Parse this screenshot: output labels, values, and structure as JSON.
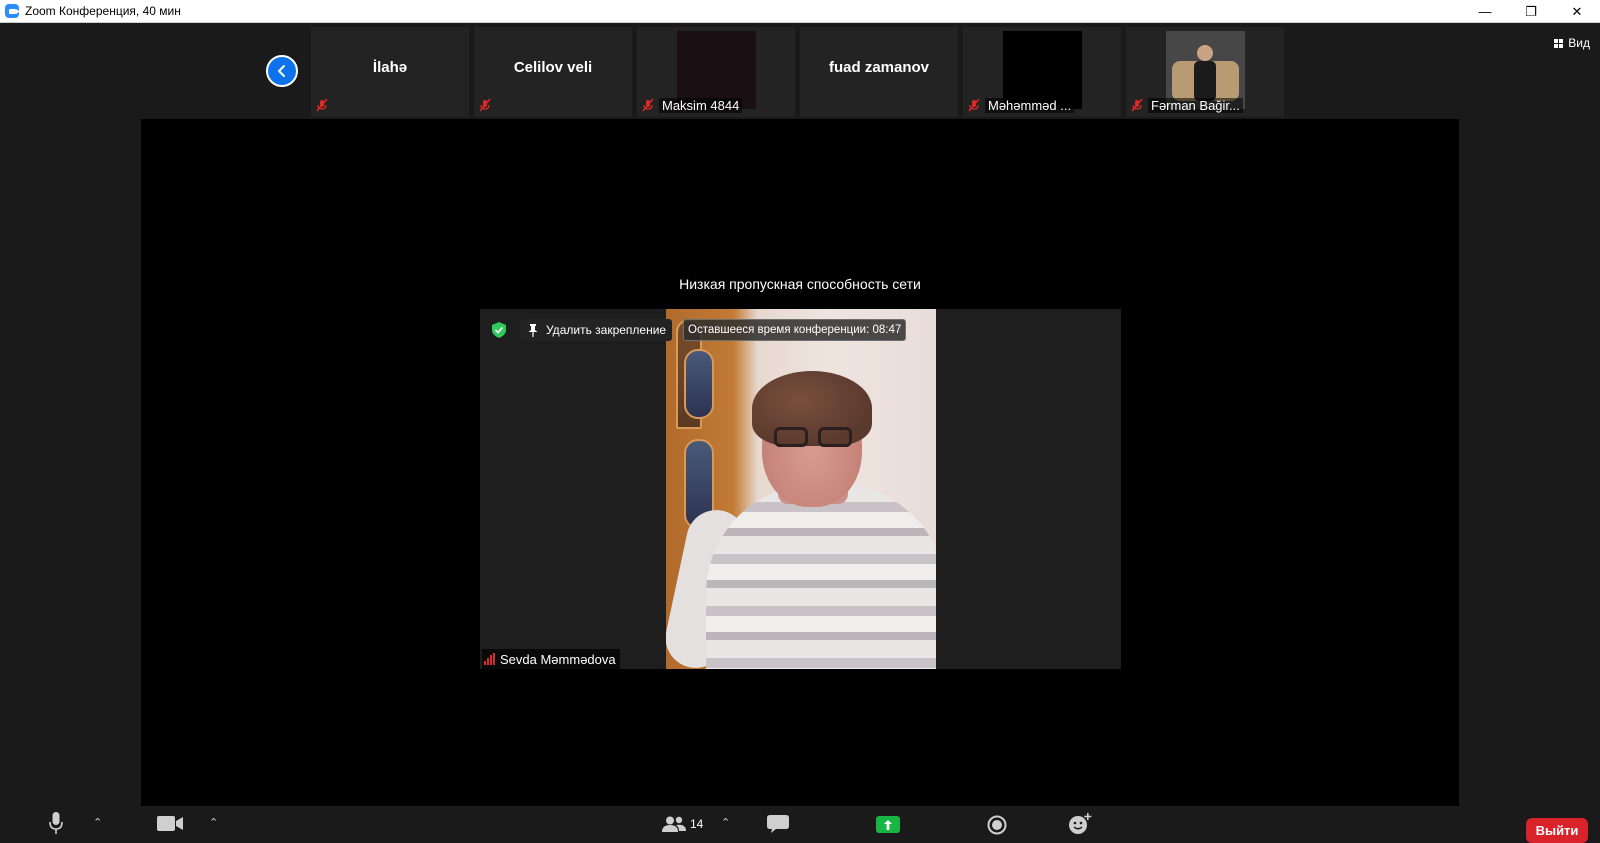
{
  "window": {
    "title": "Zoom Конференция, 40 мин",
    "controls": [
      "—",
      "❐",
      "✕"
    ]
  },
  "strip": {
    "tiles": [
      {
        "name": "İlahə",
        "display": "text",
        "muted": true
      },
      {
        "name": "Celilov veli",
        "display": "text",
        "muted": true
      },
      {
        "name": "Maksim 4844",
        "display": "video",
        "muted": true
      },
      {
        "name": "fuad zamanov",
        "display": "text",
        "muted": false
      },
      {
        "name": "Məhəmməd ...",
        "display": "video",
        "muted": true
      },
      {
        "name": "Fərman Bağir...",
        "display": "video",
        "muted": true
      }
    ],
    "view_label": "Вид"
  },
  "stage": {
    "bandwidth_notice": "Низкая пропускная способность сети",
    "unpin_label": "Удалить закрепление",
    "time_remaining": "Оставшееся время конференции: 08:47",
    "active_speaker": "Sevda Məmmədova"
  },
  "toolbar": {
    "participant_count": "14",
    "leave_label": "Выйти"
  },
  "colors": {
    "accent": "#0e72ed",
    "muted_red": "#e02828",
    "share_green": "#19b542",
    "leave_red": "#d8232a",
    "shield_green": "#2fc95c"
  }
}
